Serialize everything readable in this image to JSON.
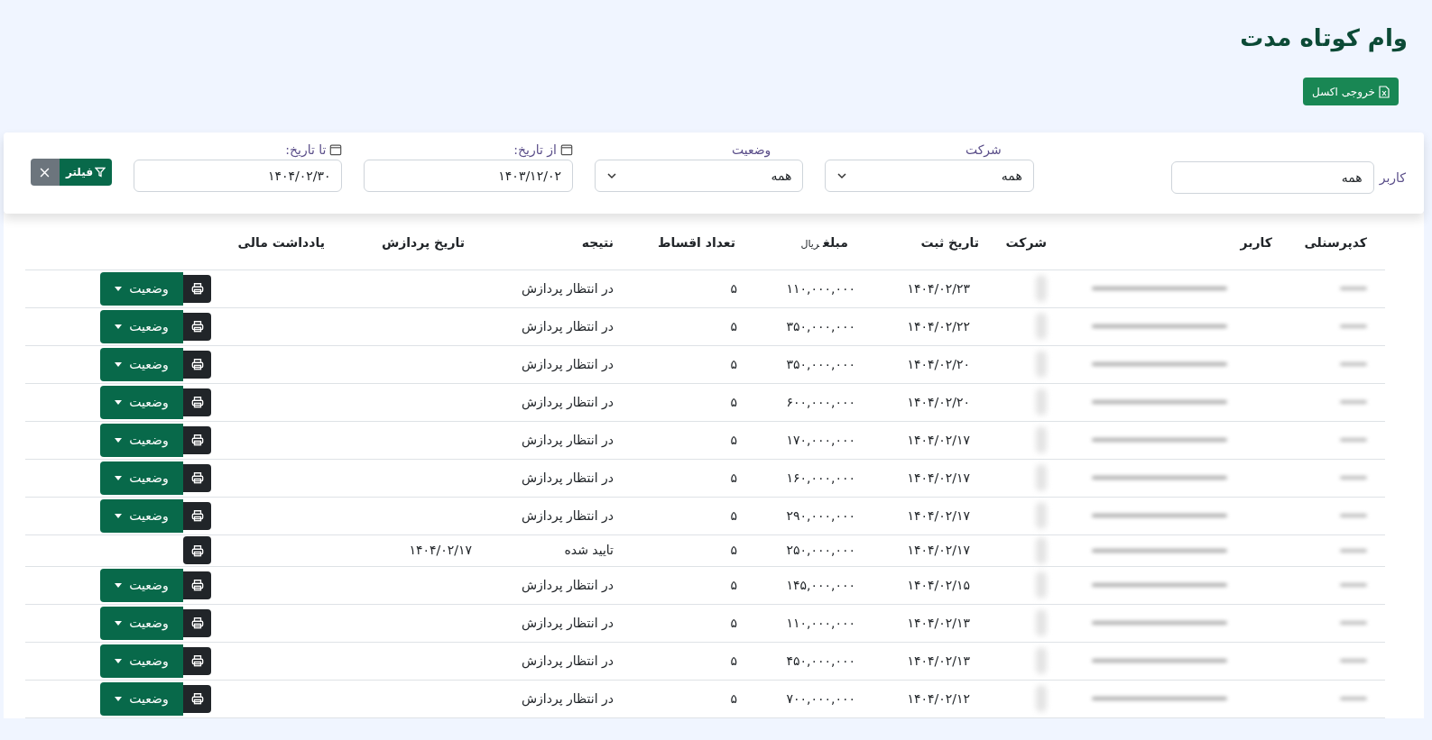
{
  "title": "وام کوتاه مدت",
  "export_button": {
    "label": "خروجی اکسل"
  },
  "filters": {
    "user": {
      "label": "کاربر",
      "value": "همه"
    },
    "company": {
      "label": "شرکت",
      "value": "همه"
    },
    "status": {
      "label": "وضعیت",
      "value": "همه"
    },
    "from_date": {
      "label": "از تاریخ:",
      "value": "۱۴۰۳/۱۲/۰۲"
    },
    "to_date": {
      "label": "تا تاریخ:",
      "value": "۱۴۰۴/۰۲/۳۰"
    },
    "filter_button": "فیلتر"
  },
  "table": {
    "columns": [
      {
        "label": "کدپرسنلی"
      },
      {
        "label": "کاربر"
      },
      {
        "label": "شرکت"
      },
      {
        "label": "تاریخ ثبت"
      },
      {
        "label": "مبلغ",
        "unit": "ریال"
      },
      {
        "label": "تعداد اقساط"
      },
      {
        "label": "نتیجه"
      },
      {
        "label": "تاریخ پردازش"
      },
      {
        "label": "یادداشت مالی"
      }
    ],
    "rows": [
      {
        "date": "۱۴۰۴/۰۲/۲۳",
        "amount": "۱۱۰,۰۰۰,۰۰۰",
        "installments": "۵",
        "result": "در انتظار پردازش",
        "status_button": "وضعیت"
      },
      {
        "date": "۱۴۰۴/۰۲/۲۲",
        "amount": "۳۵۰,۰۰۰,۰۰۰",
        "installments": "۵",
        "result": "در انتظار پردازش",
        "status_button": "وضعیت"
      },
      {
        "date": "۱۴۰۴/۰۲/۲۰",
        "amount": "۳۵۰,۰۰۰,۰۰۰",
        "installments": "۵",
        "result": "در انتظار پردازش",
        "status_button": "وضعیت"
      },
      {
        "date": "۱۴۰۴/۰۲/۲۰",
        "amount": "۶۰۰,۰۰۰,۰۰۰",
        "installments": "۵",
        "result": "در انتظار پردازش",
        "status_button": "وضعیت"
      },
      {
        "date": "۱۴۰۴/۰۲/۱۷",
        "amount": "۱۷۰,۰۰۰,۰۰۰",
        "installments": "۵",
        "result": "در انتظار پردازش",
        "status_button": "وضعیت"
      },
      {
        "date": "۱۴۰۴/۰۲/۱۷",
        "amount": "۱۶۰,۰۰۰,۰۰۰",
        "installments": "۵",
        "result": "در انتظار پردازش",
        "status_button": "وضعیت"
      },
      {
        "date": "۱۴۰۴/۰۲/۱۷",
        "amount": "۲۹۰,۰۰۰,۰۰۰",
        "installments": "۵",
        "result": "در انتظار پردازش",
        "status_button": "وضعیت"
      },
      {
        "date": "۱۴۰۴/۰۲/۱۷",
        "amount": "۲۵۰,۰۰۰,۰۰۰",
        "installments": "۵",
        "result": "تایید شده",
        "processed_date": "۱۴۰۴/۰۲/۱۷"
      },
      {
        "date": "۱۴۰۴/۰۲/۱۵",
        "amount": "۱۴۵,۰۰۰,۰۰۰",
        "installments": "۵",
        "result": "در انتظار پردازش",
        "status_button": "وضعیت"
      },
      {
        "date": "۱۴۰۴/۰۲/۱۳",
        "amount": "۱۱۰,۰۰۰,۰۰۰",
        "installments": "۵",
        "result": "در انتظار پردازش",
        "status_button": "وضعیت"
      },
      {
        "date": "۱۴۰۴/۰۲/۱۳",
        "amount": "۴۵۰,۰۰۰,۰۰۰",
        "installments": "۵",
        "result": "در انتظار پردازش",
        "status_button": "وضعیت"
      },
      {
        "date": "۱۴۰۴/۰۲/۱۲",
        "amount": "۷۰۰,۰۰۰,۰۰۰",
        "installments": "۵",
        "result": "در انتظار پردازش",
        "status_button": "وضعیت"
      }
    ]
  }
}
